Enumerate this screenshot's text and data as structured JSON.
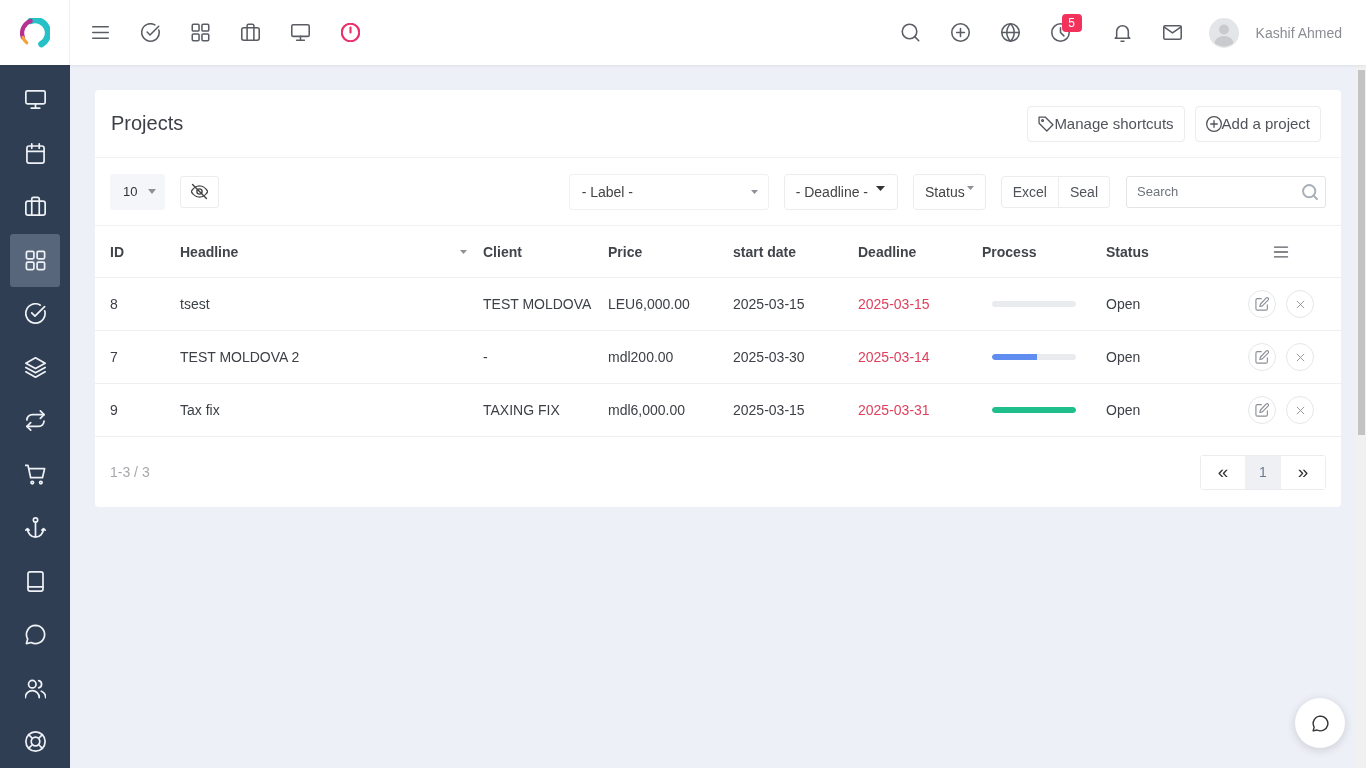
{
  "topbar": {
    "notification_badge": "5",
    "user_name": "Kashif Ahmed"
  },
  "sidebar": {
    "items": [
      {
        "selected": false
      },
      {
        "selected": false
      },
      {
        "selected": false
      },
      {
        "selected": true
      },
      {
        "selected": false
      },
      {
        "selected": false
      },
      {
        "selected": false
      },
      {
        "selected": false
      },
      {
        "selected": false
      },
      {
        "selected": false
      },
      {
        "selected": false
      },
      {
        "selected": false
      },
      {
        "selected": false
      }
    ]
  },
  "projects": {
    "title": "Projects",
    "actions": [
      {
        "label": "Manage shortcuts"
      },
      {
        "label": "Add a project"
      }
    ],
    "toolbar": {
      "page_size": "10",
      "label_filter": "- Label -",
      "deadline_filter": "- Deadline -",
      "status_filter": "Status",
      "exports": [
        "Excel",
        "Seal"
      ],
      "search": {
        "placeholder": "Search"
      }
    },
    "table": {
      "columns": [
        {
          "label": "ID",
          "sorted": false
        },
        {
          "label": "Headline",
          "sorted": true
        },
        {
          "label": "Client",
          "sorted": false
        },
        {
          "label": "Price",
          "sorted": false
        },
        {
          "label": "start date",
          "sorted": false
        },
        {
          "label": "Deadline",
          "sorted": false
        },
        {
          "label": "Process",
          "sorted": false
        },
        {
          "label": "Status",
          "sorted": false
        }
      ],
      "rows": [
        {
          "id": "8",
          "headline": "tsest",
          "client": "TEST MOLDOVA",
          "price": "LEU6,000.00",
          "start_date": "2025-03-15",
          "deadline": "2025-03-15",
          "overdue": true,
          "level": 0,
          "status": "Open"
        },
        {
          "id": "7",
          "headline": "TEST MOLDOVA 2",
          "client": "-",
          "price": "mdl200.00",
          "start_date": "2025-03-30",
          "deadline": "2025-03-14",
          "overdue": true,
          "level": 0.54,
          "status": "Open"
        },
        {
          "id": "9",
          "headline": "Tax fix",
          "client": "TAXING FIX",
          "price": "mdl6,000.00",
          "start_date": "2025-03-15",
          "deadline": "2025-03-31",
          "overdue": true,
          "level": 1,
          "status": "Open"
        }
      ]
    },
    "footer": {
      "summary": "1-3 / 3",
      "pagination": {
        "previous": "«",
        "pages": [
          {
            "label": "1",
            "selected": true
          }
        ],
        "next": "»"
      }
    }
  }
}
